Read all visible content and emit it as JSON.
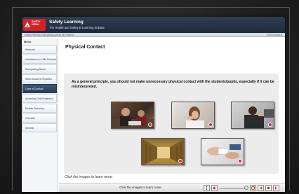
{
  "header": {
    "logo_text": [
      "SAFETY",
      "MEDIA"
    ],
    "app_title": "Safety Learning",
    "app_subtitle": "The Health and Safety E-Learning Solution"
  },
  "subbar": {
    "course_title": "CHILD PROTECTION (EDUCATION SETTINGS)",
    "exit_label": "EXIT MODULE"
  },
  "sidebar": {
    "title": "Menu",
    "items": [
      {
        "label": "Welcome"
      },
      {
        "label": "Introduction to Child Protection"
      },
      {
        "label": "Recognising Abuse"
      },
      {
        "label": "When Abuse is Reported"
      },
      {
        "label": "Code of Conduct",
        "active": true
      },
      {
        "label": "Achieving Child Protection"
      },
      {
        "label": "Module Summary"
      },
      {
        "label": "Checklist"
      },
      {
        "label": "Self-test"
      }
    ]
  },
  "main": {
    "page_title": "Physical Contact",
    "intro": "As a general principle, you should not make unnecessary physical contact with the students/pupils, especially if it can be misinterpreted.",
    "caption": "Click the images to learn more.",
    "images": [
      {
        "name": "classroom-image"
      },
      {
        "name": "distressed-student-image"
      },
      {
        "name": "hand-on-shoulder-image"
      },
      {
        "name": "corridor-image"
      },
      {
        "name": "first-aid-image"
      }
    ]
  },
  "footer": {
    "instruction": "Click the images to learn more.",
    "player": {
      "volume": 0.85
    }
  },
  "colors": {
    "header": "#1d2939",
    "logo": "#d42027",
    "active_menu": "#2a3f59",
    "badge": "#c4285a",
    "player_buttons": "#c0262c"
  }
}
